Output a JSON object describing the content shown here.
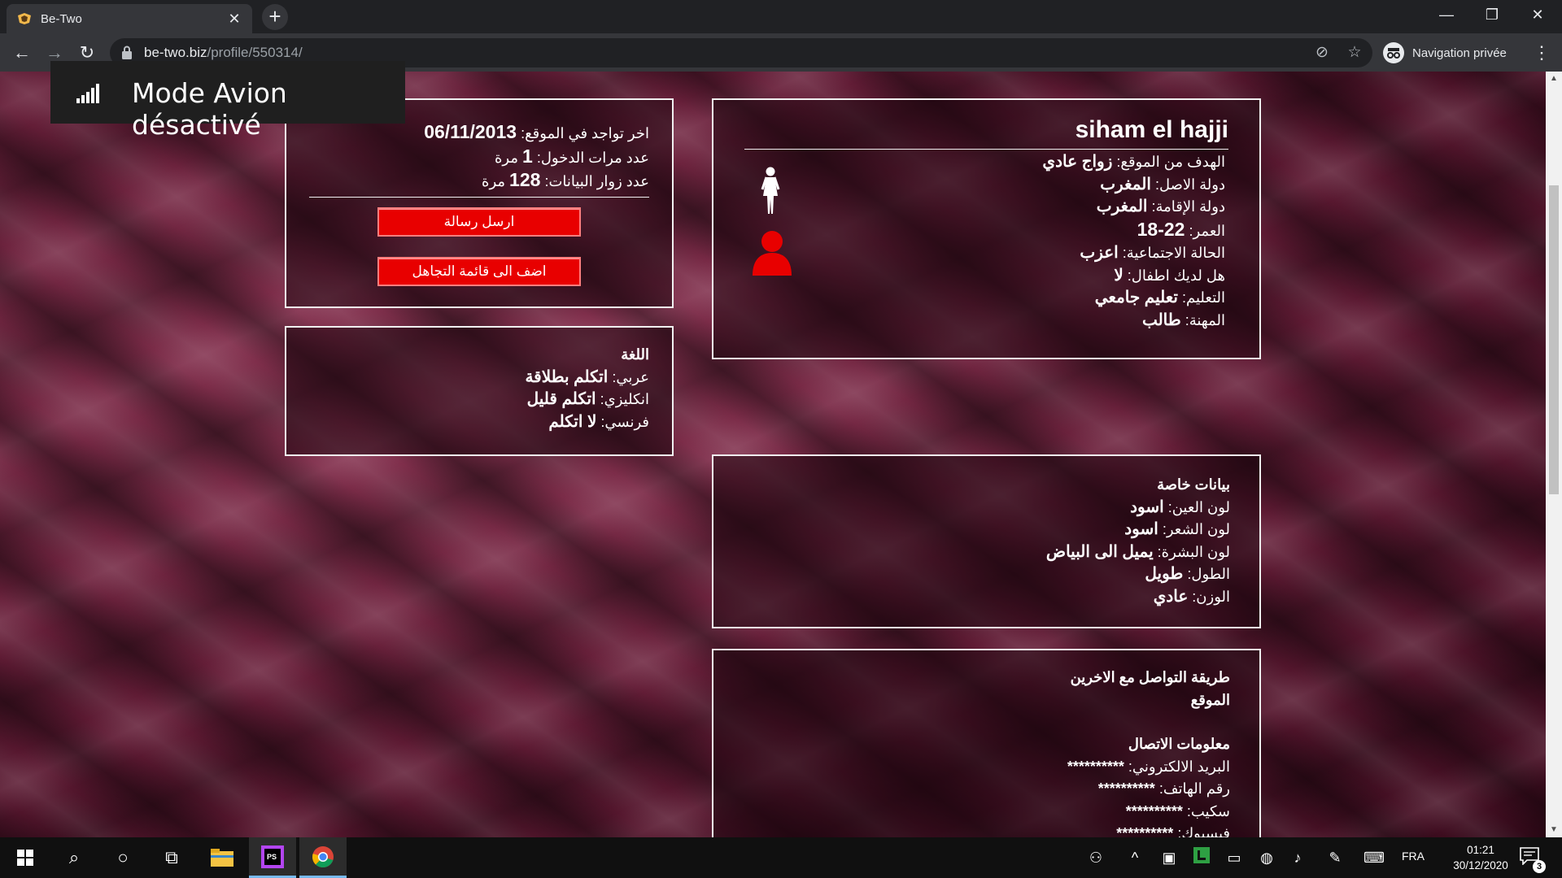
{
  "browser": {
    "tab_title": "Be-Two",
    "url_host": "be-two.biz",
    "url_path": "/profile/550314/",
    "incognito_label": "Navigation privée"
  },
  "osd": {
    "text": "Mode Avion désactivé"
  },
  "profile": {
    "name": "siham el hajji",
    "fields": [
      {
        "label": "الهدف من الموقع:",
        "value": "زواج عادي"
      },
      {
        "label": "دولة الاصل:",
        "value": "المغرب"
      },
      {
        "label": "دولة الإقامة:",
        "value": "المغرب"
      },
      {
        "label": "العمر:",
        "value": "18-22"
      },
      {
        "label": "الحالة الاجتماعية:",
        "value": "اعزب"
      },
      {
        "label": "هل لديك اطفال:",
        "value": "لا"
      },
      {
        "label": "التعليم:",
        "value": "تعليم جامعي"
      },
      {
        "label": "المهنة:",
        "value": "طالب"
      }
    ]
  },
  "stats": {
    "last_seen_label": "اخر تواجد في الموقع:",
    "last_seen_value": "06/11/2013",
    "logins_label": "عدد مرات الدخول:",
    "logins_value": "1",
    "logins_unit": "مرة",
    "visitors_label": "عدد زوار البيانات:",
    "visitors_value": "128",
    "visitors_unit": "مرة",
    "send_message_label": "ارسل رسالة",
    "ignore_list_label": "اضف الى قائمة التجاهل"
  },
  "language": {
    "title": "اللغة",
    "items": [
      {
        "label": "عربي:",
        "value": "اتكلم بطلاقة"
      },
      {
        "label": "انكليزي:",
        "value": "اتكلم قليل"
      },
      {
        "label": "فرنسي:",
        "value": "لا اتكلم"
      }
    ]
  },
  "special": {
    "title": "بيانات خاصة",
    "items": [
      {
        "label": "لون العين:",
        "value": "اسود"
      },
      {
        "label": "لون الشعر:",
        "value": "اسود"
      },
      {
        "label": "لون البشرة:",
        "value": "يميل الى البياض"
      },
      {
        "label": "الطول:",
        "value": "طويل"
      },
      {
        "label": "الوزن:",
        "value": "عادي"
      }
    ]
  },
  "contact": {
    "method_title": "طريقة التواصل مع الاخرين",
    "method_value": "الموقع",
    "info_title": "معلومات الاتصال",
    "items": [
      {
        "label": "البريد الالكتروني:",
        "value": "**********"
      },
      {
        "label": "رقم الهاتف:",
        "value": "**********"
      },
      {
        "label": "سكيب:",
        "value": "**********"
      },
      {
        "label": "فيسبوك:",
        "value": "**********"
      }
    ]
  },
  "taskbar": {
    "lang": "FRA",
    "time": "01:21",
    "date": "30/12/2020",
    "notification_count": "3"
  },
  "colors": {
    "button_red": "#e80000",
    "background_maroon": "#5e1a33",
    "avatar_red": "#e80000"
  }
}
